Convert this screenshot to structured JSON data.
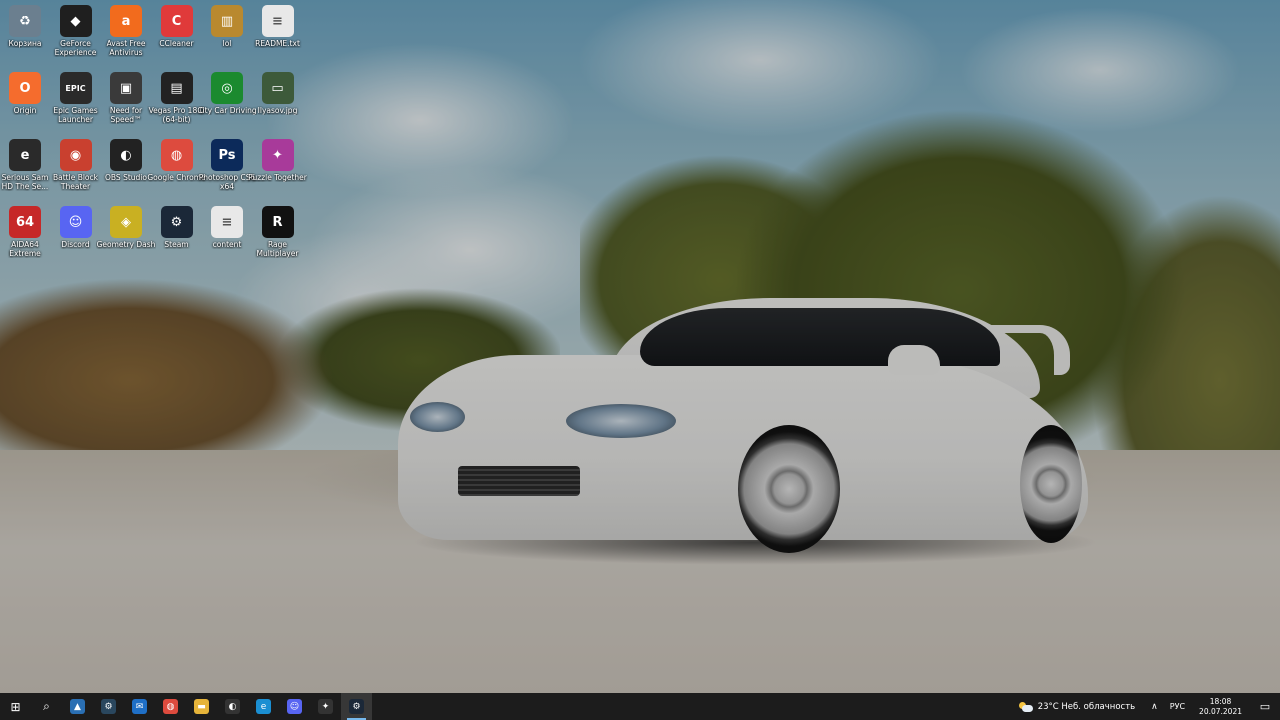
{
  "desktop_icons": [
    {
      "label": "Корзина",
      "glyph": "♻",
      "icon": "recycle-bin-icon",
      "color": "#6b7f8f"
    },
    {
      "label": "GeForce Experience",
      "glyph": "◆",
      "icon": "nvidia-icon",
      "color": "#1f1f1f"
    },
    {
      "label": "Avast Free Antivirus",
      "glyph": "a",
      "icon": "avast-icon",
      "color": "#f26b1d"
    },
    {
      "label": "CCleaner",
      "glyph": "C",
      "icon": "ccleaner-icon",
      "color": "#e03a3a"
    },
    {
      "label": "lol",
      "glyph": "▥",
      "icon": "archive-icon",
      "color": "#b9892f"
    },
    {
      "label": "README.txt",
      "glyph": "≡",
      "icon": "text-file-icon",
      "color": "#e8e8e8"
    },
    {
      "label": "Origin",
      "glyph": "O",
      "icon": "origin-icon",
      "color": "#f56c2d"
    },
    {
      "label": "Epic Games Launcher",
      "glyph": "EPIC",
      "icon": "epic-games-icon",
      "color": "#2a2a2a"
    },
    {
      "label": "Need for Speed™",
      "glyph": "▣",
      "icon": "nfs-icon",
      "color": "#3a3a3a"
    },
    {
      "label": "Vegas Pro 18.0 (64-bit)",
      "glyph": "▤",
      "icon": "vegas-pro-icon",
      "color": "#222"
    },
    {
      "label": "City Car Driving",
      "glyph": "◎",
      "icon": "city-car-driving-icon",
      "color": "#1b8a2f"
    },
    {
      "label": "Ilyasov.jpg",
      "glyph": "▭",
      "icon": "image-file-icon",
      "color": "#3d5a3a"
    },
    {
      "label": "Serious Sam HD The Se...",
      "glyph": "e",
      "icon": "serious-sam-icon",
      "color": "#2a2a2a"
    },
    {
      "label": "Battle Block Theater",
      "glyph": "◉",
      "icon": "battleblock-icon",
      "color": "#c9402f"
    },
    {
      "label": "OBS Studio",
      "glyph": "◐",
      "icon": "obs-icon",
      "color": "#222"
    },
    {
      "label": "Google Chrome",
      "glyph": "◍",
      "icon": "chrome-icon",
      "color": "#dd4b3e"
    },
    {
      "label": "Photoshop CS6 x64",
      "glyph": "Ps",
      "icon": "photoshop-icon",
      "color": "#0c2a5a"
    },
    {
      "label": "Puzzle Together",
      "glyph": "✦",
      "icon": "puzzle-icon",
      "color": "#a83a9a"
    },
    {
      "label": "AIDA64 Extreme",
      "glyph": "64",
      "icon": "aida64-icon",
      "color": "#c62828"
    },
    {
      "label": "Discord",
      "glyph": "☺",
      "icon": "discord-icon",
      "color": "#5865f2"
    },
    {
      "label": "Geometry Dash",
      "glyph": "◈",
      "icon": "geometry-dash-icon",
      "color": "#c9b022"
    },
    {
      "label": "Steam",
      "glyph": "⚙",
      "icon": "steam-icon",
      "color": "#1b2838"
    },
    {
      "label": "content",
      "glyph": "≡",
      "icon": "text-file-icon",
      "color": "#e8e8e8"
    },
    {
      "label": "Rage Multiplayer",
      "glyph": "R",
      "icon": "ragemp-icon",
      "color": "#111"
    }
  ],
  "taskbar": {
    "items": [
      {
        "name": "start-button",
        "glyph": "⊞",
        "icon": "windows-icon",
        "color": "#1c1c1c",
        "active": false
      },
      {
        "name": "search-button",
        "glyph": "⌕",
        "icon": "search-icon",
        "color": "#1c1c1c",
        "active": false
      },
      {
        "name": "taskbar-app-1",
        "glyph": "▲",
        "icon": "app-icon",
        "color": "#2a6fb3",
        "active": false
      },
      {
        "name": "taskbar-steam",
        "glyph": "⚙",
        "icon": "steam-icon",
        "color": "#2a475e",
        "active": false
      },
      {
        "name": "taskbar-mail",
        "glyph": "✉",
        "icon": "mail-icon",
        "color": "#1f6fc6",
        "active": false
      },
      {
        "name": "taskbar-chrome",
        "glyph": "◍",
        "icon": "chrome-icon",
        "color": "#dd4b3e",
        "active": false
      },
      {
        "name": "taskbar-explorer",
        "glyph": "▬",
        "icon": "folder-icon",
        "color": "#e6b43a",
        "active": false
      },
      {
        "name": "taskbar-obs",
        "glyph": "◐",
        "icon": "obs-icon",
        "color": "#333",
        "active": false
      },
      {
        "name": "taskbar-edge",
        "glyph": "e",
        "icon": "edge-icon",
        "color": "#1b8fd2",
        "active": false
      },
      {
        "name": "taskbar-discord",
        "glyph": "☺",
        "icon": "discord-icon",
        "color": "#5865f2",
        "active": false
      },
      {
        "name": "taskbar-app-2",
        "glyph": "✦",
        "icon": "app-icon",
        "color": "#333",
        "active": false
      },
      {
        "name": "taskbar-steam-active",
        "glyph": "⚙",
        "icon": "steam-icon",
        "color": "#1b2838",
        "active": true
      }
    ],
    "tray": {
      "weather_text": "23°C  Неб. облачность",
      "chevron": "∧",
      "language": "РУС",
      "time": "18:08",
      "date": "20.07.2021",
      "notification_glyph": "▭"
    }
  }
}
